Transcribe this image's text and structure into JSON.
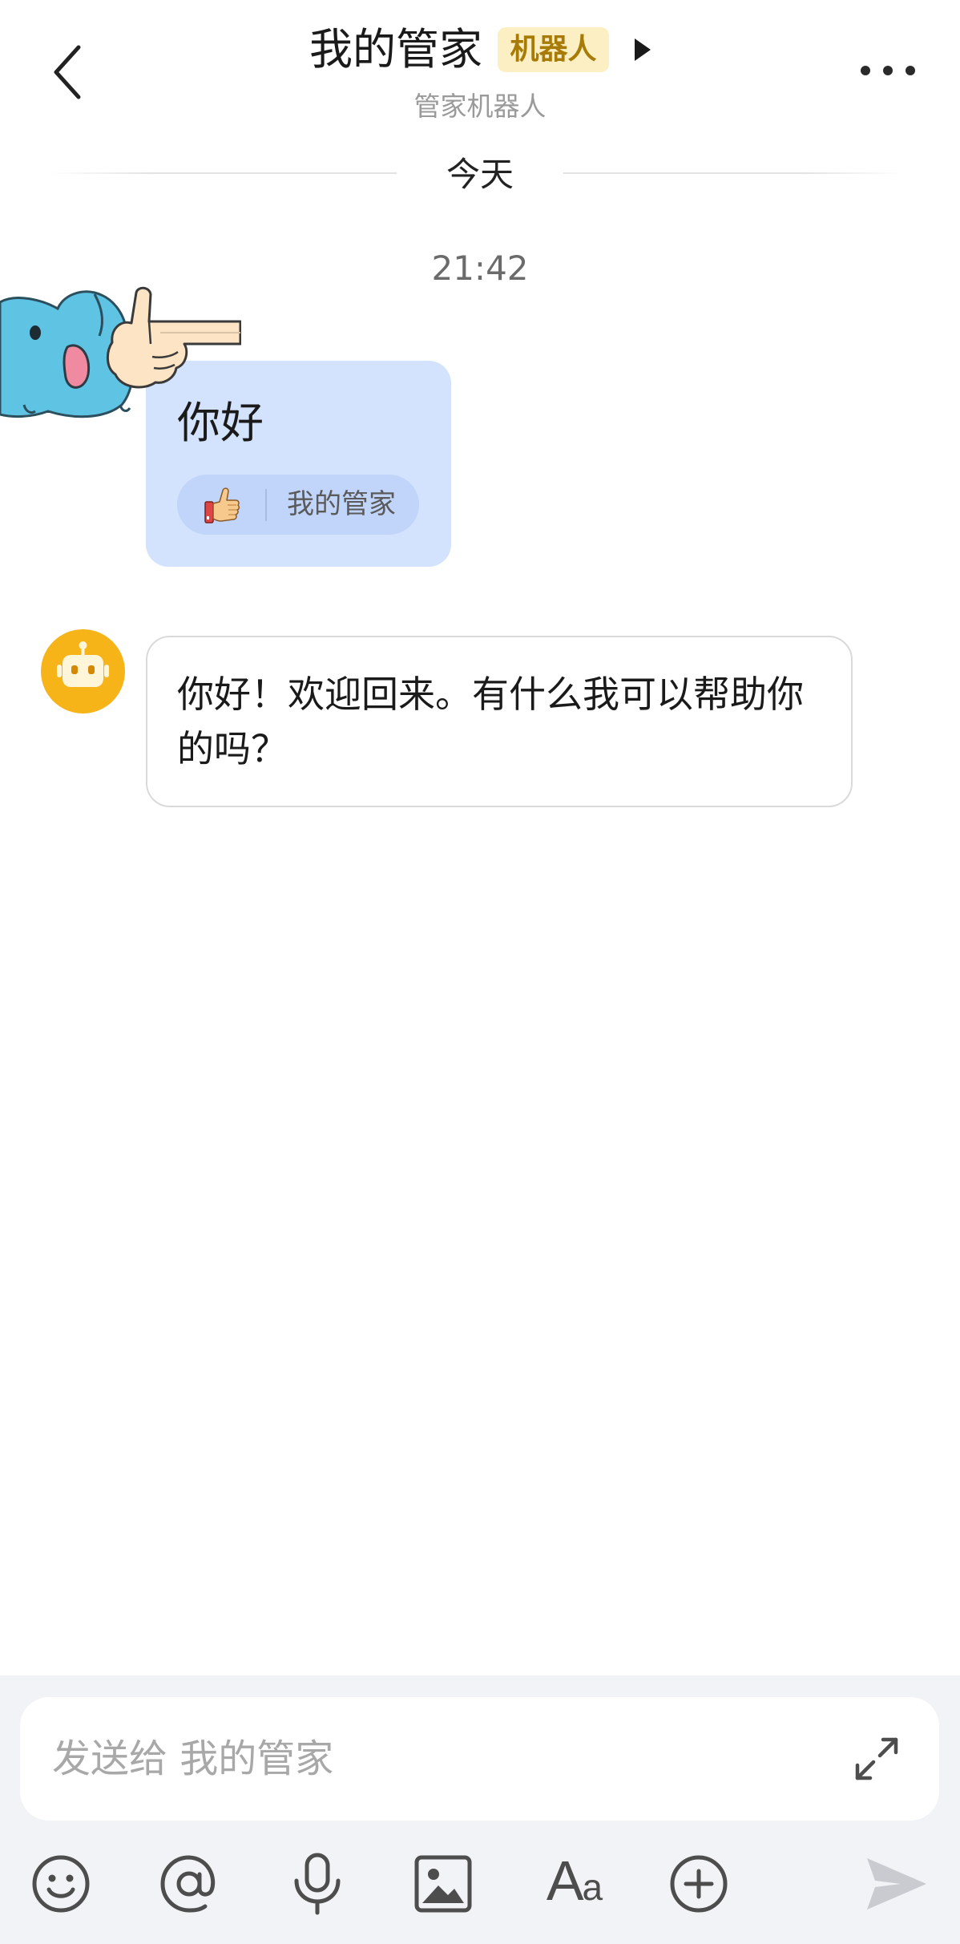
{
  "header": {
    "back_icon": "chevron-left-icon",
    "title": "我的管家",
    "badge": "机器人",
    "badge_arrow_icon": "triangle-right-icon",
    "subtitle": "管家机器人",
    "more_icon": "more-dots-icon"
  },
  "divider": {
    "label": "今天"
  },
  "timestamp": "21:42",
  "messages": [
    {
      "sender": "user",
      "sticker_icon": "elephant-thumbs-up-sticker",
      "text": "你好",
      "reaction": {
        "icon": "thumbs-up-icon",
        "by": "我的管家"
      }
    },
    {
      "sender": "bot",
      "avatar_icon": "robot-icon",
      "text": "你好！欢迎回来。有什么我可以帮助你的吗？"
    }
  ],
  "composer": {
    "placeholder": "发送给 我的管家",
    "expand_icon": "expand-icon"
  },
  "toolbar": {
    "items": [
      "emoji-icon",
      "mention-icon",
      "microphone-icon",
      "image-icon",
      "font-icon",
      "plus-circle-icon",
      "send-icon"
    ],
    "font_label_big": "A",
    "font_label_small": "a"
  },
  "colors": {
    "user_bubble": "#d3e2fd",
    "reaction_pill": "#c1d4f9",
    "badge_bg": "#fcefc4",
    "badge_text": "#a87a06",
    "bot_avatar": "#f7b418",
    "composer_bg": "#f2f3f6",
    "send_disabled": "#c9cbd0"
  }
}
